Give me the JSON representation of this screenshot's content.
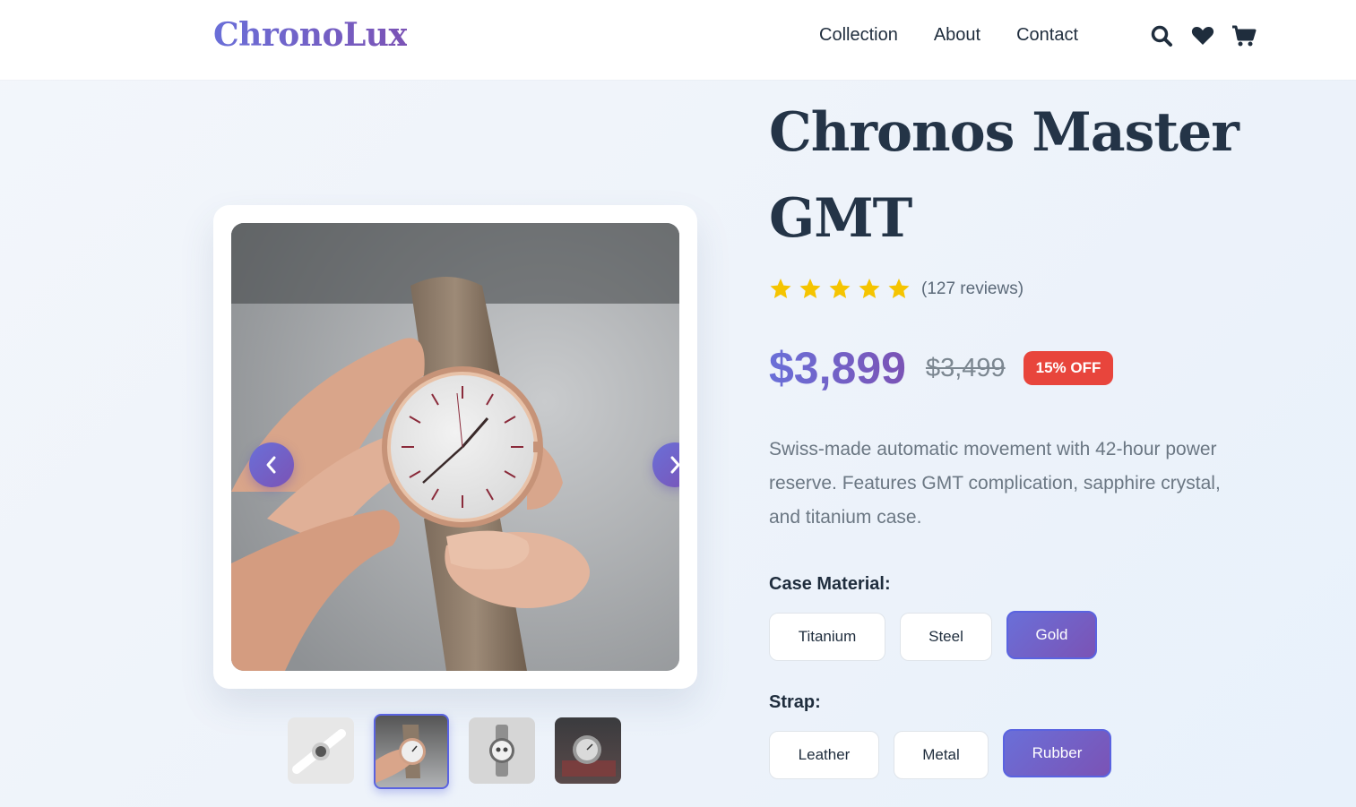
{
  "header": {
    "logo": "ChronoLux",
    "nav": [
      "Collection",
      "About",
      "Contact"
    ],
    "icons": [
      "search-icon",
      "heart-icon",
      "cart-icon"
    ]
  },
  "gallery": {
    "thumbnails": [
      "white-smartwatch",
      "hand-holding-watch",
      "chronograph-watch",
      "watch-on-dark-surface"
    ],
    "active_thumbnail_index": 1
  },
  "product": {
    "title": "Chronos Master GMT",
    "rating_stars": 5,
    "reviews": "(127 reviews)",
    "price": "$3,899",
    "old_price": "$3,499",
    "discount_badge": "15% OFF",
    "description": "Swiss-made automatic movement with 42-hour power reserve. Features GMT complication, sapphire crystal, and titanium case.",
    "case_material": {
      "label": "Case Material:",
      "options": [
        "Titanium",
        "Steel",
        "Gold"
      ],
      "selected": "Gold"
    },
    "strap": {
      "label": "Strap:",
      "options": [
        "Leather",
        "Metal",
        "Rubber"
      ],
      "selected": "Rubber"
    }
  },
  "colors": {
    "accent_start": "#6a6fd8",
    "accent_end": "#7b53b5",
    "badge": "#e8453c",
    "star": "#f5c400",
    "text_dark": "#243447"
  }
}
